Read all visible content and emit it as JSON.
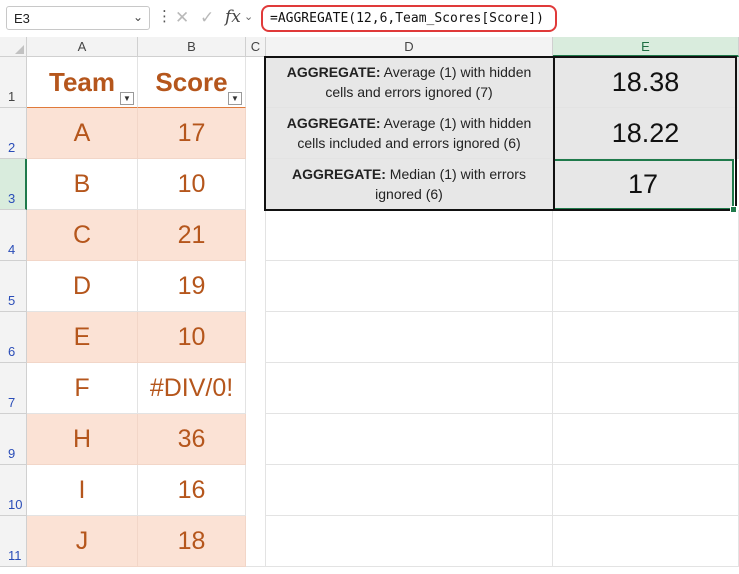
{
  "name_box": {
    "value": "E3"
  },
  "formula_bar": {
    "formula": "=AGGREGATE(12,6,Team_Scores[Score])"
  },
  "columns": [
    "A",
    "B",
    "C",
    "D",
    "E"
  ],
  "rows": [
    "1",
    "2",
    "3",
    "4",
    "5",
    "6",
    "7",
    "9",
    "10",
    "11"
  ],
  "table": {
    "headers": {
      "team": "Team",
      "score": "Score"
    },
    "rows": [
      {
        "team": "A",
        "score": "17"
      },
      {
        "team": "B",
        "score": "10"
      },
      {
        "team": "C",
        "score": "21"
      },
      {
        "team": "D",
        "score": "19"
      },
      {
        "team": "E",
        "score": "10"
      },
      {
        "team": "F",
        "score": "#DIV/0!"
      },
      {
        "team": "H",
        "score": "36"
      },
      {
        "team": "I",
        "score": "16"
      },
      {
        "team": "J",
        "score": "18"
      }
    ]
  },
  "results": [
    {
      "bold": "AGGREGATE:",
      "text": " Average (1) with hidden cells and errors ignored (7)",
      "value": "18.38"
    },
    {
      "bold": "AGGREGATE:",
      "text": " Average (1) with hidden cells included and errors ignored (6)",
      "value": "18.22"
    },
    {
      "bold": "AGGREGATE:",
      "text": " Median (1) with errors ignored (6)",
      "value": "17"
    }
  ],
  "colors": {
    "accent": "#b5561c",
    "band": "#fbe2d5",
    "selection": "#1f7a4b",
    "formula_highlight": "#e03a3a"
  }
}
